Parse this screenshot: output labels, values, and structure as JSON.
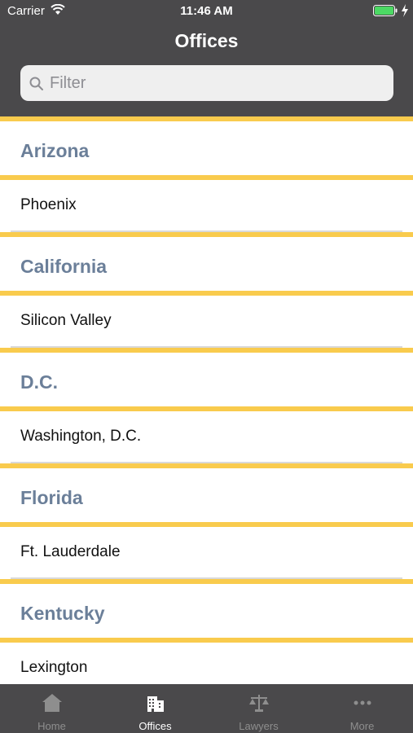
{
  "status_bar": {
    "carrier": "Carrier",
    "time": "11:46 AM"
  },
  "nav": {
    "title": "Offices"
  },
  "search": {
    "placeholder": "Filter"
  },
  "sections": [
    {
      "header": "Arizona",
      "rows": [
        "Phoenix"
      ]
    },
    {
      "header": "California",
      "rows": [
        "Silicon Valley"
      ]
    },
    {
      "header": "D.C.",
      "rows": [
        "Washington, D.C."
      ]
    },
    {
      "header": "Florida",
      "rows": [
        "Ft. Lauderdale"
      ]
    },
    {
      "header": "Kentucky",
      "rows": [
        "Lexington"
      ]
    }
  ],
  "tabs": [
    {
      "label": "Home",
      "icon": "home-icon",
      "active": false
    },
    {
      "label": "Offices",
      "icon": "building-icon",
      "active": true
    },
    {
      "label": "Lawyers",
      "icon": "scales-icon",
      "active": false
    },
    {
      "label": "More",
      "icon": "more-icon",
      "active": false
    }
  ],
  "colors": {
    "header_bg": "#4a494b",
    "accent_yellow": "#f9cb4d",
    "section_text": "#6b7f99",
    "battery_green": "#4cd964"
  }
}
